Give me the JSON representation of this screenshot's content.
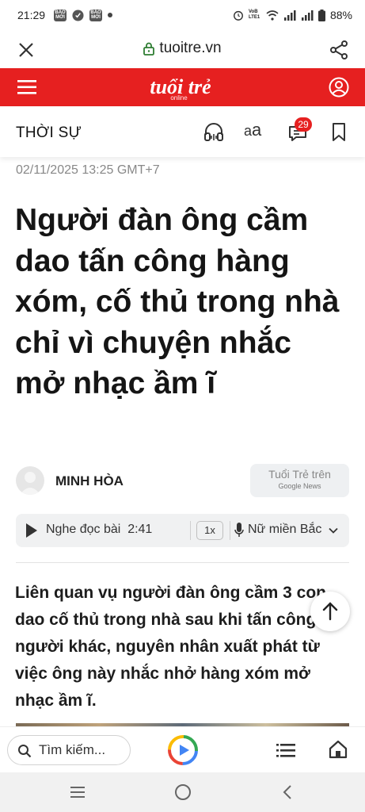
{
  "status_bar": {
    "time": "21:29",
    "badge1": "BÁO MỚI",
    "badge2": "BÁO MỚI",
    "network": "VoB LTE1",
    "battery": "88%",
    "icons": [
      "notification-badge-icon",
      "app-icon",
      "dot-icon",
      "alarm-icon",
      "wifi-icon",
      "signal-icon",
      "battery-icon"
    ]
  },
  "browser": {
    "url": "tuoitre.vn",
    "close_icon": "close-icon",
    "lock_icon": "lock-icon",
    "share_icon": "share-icon"
  },
  "site_header": {
    "brand_color": "#e62020",
    "logo_text": "tuổi trẻ",
    "logo_sub": "online",
    "menu_icon": "menu-icon",
    "user_icon": "user-icon"
  },
  "section_bar": {
    "title": "THỜI SỰ",
    "font_toggle_small": "a",
    "font_toggle_large": "a",
    "comment_count": "29",
    "icons": [
      "headphones-icon",
      "font-size-icon",
      "comment-icon",
      "bookmark-icon"
    ]
  },
  "article": {
    "date": "02/11/2025 13:25 GMT+7",
    "headline": "Người đàn ông cầm dao tấn công hàng xóm, cố thủ trong nhà chỉ vì chuyện nhắc mở nhạc ầm ĩ",
    "author": "MINH HÒA",
    "gnews_line1": "Tuổi Trẻ trên",
    "gnews_line2": "Google News",
    "sapo": "Liên quan vụ người đàn ông cầm 3 con dao cố thủ trong nhà sau khi tấn công người khác, nguyên nhân xuất phát từ việc ông này nhắc nhở hàng xóm mở nhạc ầm ĩ."
  },
  "audio_player": {
    "label": "Nghe đọc bài",
    "duration": "2:41",
    "speed": "1x",
    "voice": "Nữ miền Bắc"
  },
  "bottom_nav": {
    "search_placeholder": "Tìm kiếm...",
    "icons": [
      "search-icon",
      "google-play-icon",
      "list-icon",
      "home-icon"
    ]
  },
  "system_nav": {
    "icons": [
      "recents-icon",
      "home-circle-icon",
      "back-icon"
    ]
  }
}
